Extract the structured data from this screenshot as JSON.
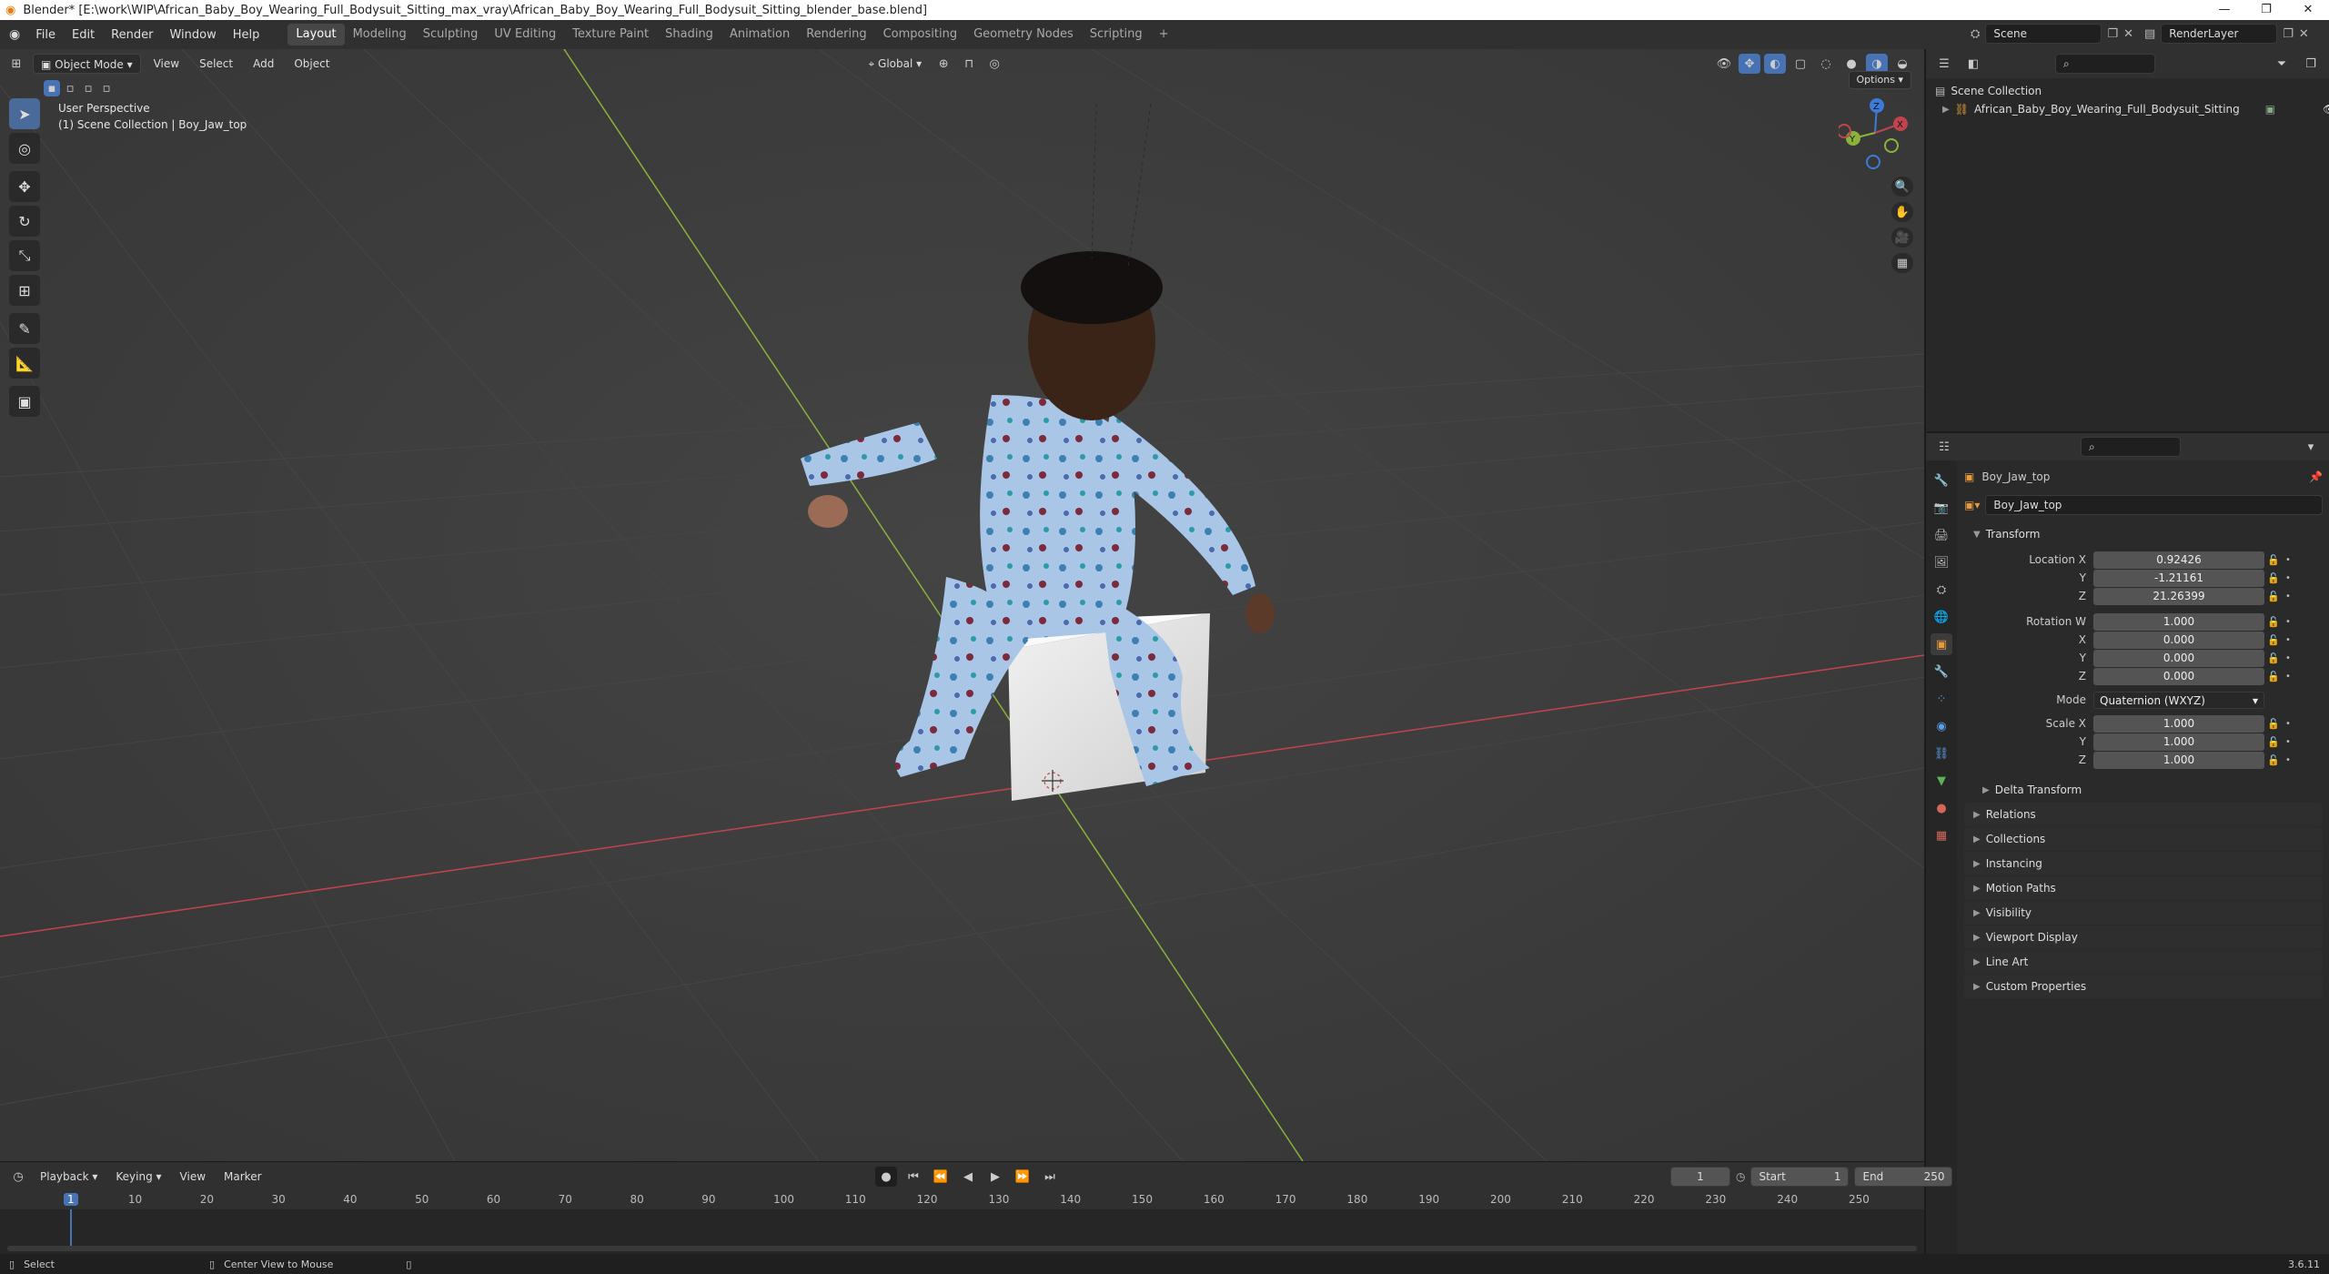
{
  "title_bar": {
    "title": "Blender* [E:\\work\\WIP\\African_Baby_Boy_Wearing_Full_Bodysuit_Sitting_max_vray\\African_Baby_Boy_Wearing_Full_Bodysuit_Sitting_blender_base.blend]",
    "minimize": "—",
    "restore": "❐",
    "close": "✕"
  },
  "menu": {
    "items": [
      "File",
      "Edit",
      "Render",
      "Window",
      "Help"
    ],
    "workspaces": [
      "Layout",
      "Modeling",
      "Sculpting",
      "UV Editing",
      "Texture Paint",
      "Shading",
      "Animation",
      "Rendering",
      "Compositing",
      "Geometry Nodes",
      "Scripting"
    ],
    "active_workspace": "Layout",
    "add_workspace": "+",
    "scene": "Scene",
    "view_layer": "RenderLayer"
  },
  "viewport": {
    "mode": "Object Mode",
    "menus": [
      "View",
      "Select",
      "Add",
      "Object"
    ],
    "orientation": "Global",
    "options": "Options",
    "info_line1": "User Perspective",
    "info_line2": "(1) Scene Collection | Boy_Jaw_top",
    "gizmo_labels": [
      "Z",
      "Y",
      "X"
    ]
  },
  "outliner": {
    "search_placeholder": "",
    "root": "Scene Collection",
    "items": [
      "African_Baby_Boy_Wearing_Full_Bodysuit_Sitting"
    ]
  },
  "properties": {
    "object_name": "Boy_Jaw_top",
    "data_name": "Boy_Jaw_top",
    "transform_title": "Transform",
    "location": {
      "label": "Location X",
      "x": "0.92426",
      "y": "-1.21161",
      "z": "21.26399"
    },
    "rotation": {
      "label": "Rotation W",
      "w": "1.000",
      "x": "0.000",
      "y": "0.000",
      "z": "0.000"
    },
    "mode_label": "Mode",
    "mode_value": "Quaternion (WXYZ)",
    "scale": {
      "label": "Scale X",
      "x": "1.000",
      "y": "1.000",
      "z": "1.000"
    },
    "axis_labels": [
      "X",
      "Y",
      "Z"
    ],
    "delta_transform": "Delta Transform",
    "panels": [
      "Relations",
      "Collections",
      "Instancing",
      "Motion Paths",
      "Visibility",
      "Viewport Display",
      "Line Art",
      "Custom Properties"
    ]
  },
  "timeline": {
    "menus": [
      "Playback",
      "Keying",
      "View",
      "Marker"
    ],
    "current_frame": "1",
    "start_label": "Start",
    "start": "1",
    "end_label": "End",
    "end": "250",
    "ruler_marks": [
      "1",
      "10",
      "20",
      "30",
      "40",
      "50",
      "60",
      "70",
      "80",
      "90",
      "100",
      "110",
      "120",
      "130",
      "140",
      "150",
      "160",
      "170",
      "180",
      "190",
      "200",
      "210",
      "220",
      "230",
      "240",
      "250"
    ]
  },
  "status": {
    "select": "Select",
    "center_view": "Center View to Mouse",
    "version": "3.6.11"
  },
  "colors": {
    "accent": "#4772b3",
    "viewport_bg": "#3d3d3d",
    "x_axis": "#c0444e",
    "y_axis": "#8bb33b"
  }
}
